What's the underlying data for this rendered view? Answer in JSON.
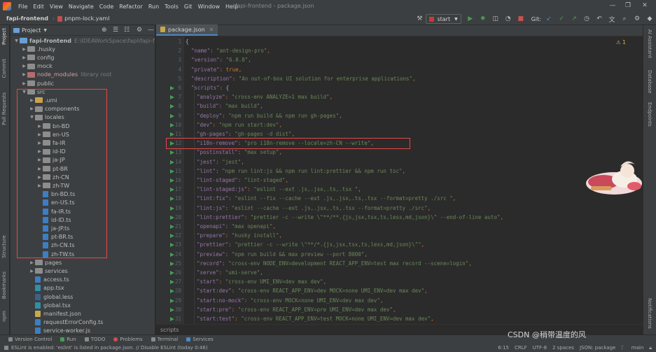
{
  "menu": {
    "items": [
      "File",
      "Edit",
      "View",
      "Navigate",
      "Code",
      "Refactor",
      "Run",
      "Tools",
      "Git",
      "Window",
      "Help"
    ],
    "window_title": "fapi-frontend - package.json"
  },
  "nav": {
    "project": "fapi-frontend",
    "file": "pnpm-lock.yaml",
    "run_config": "start",
    "git_label": "Git:"
  },
  "left_strip": {
    "project": "Project",
    "commit": "Commit",
    "pull_requests": "Pull Requests",
    "structure": "Structure",
    "bookmarks": "Bookmarks",
    "npm": "npm"
  },
  "project_panel": {
    "title": "Project",
    "tree": [
      {
        "label": "fapi-frontend",
        "note": "E:\\IDEAWorkSpace\\fapi\\fapi-fronte",
        "depth": 0,
        "kind": "folder",
        "open": true
      },
      {
        "label": ".husky",
        "depth": 1,
        "kind": "folder"
      },
      {
        "label": "config",
        "depth": 1,
        "kind": "folder"
      },
      {
        "label": "mock",
        "depth": 1,
        "kind": "folder"
      },
      {
        "label": "node_modules",
        "note": "library root",
        "depth": 1,
        "kind": "folder-excluded"
      },
      {
        "label": "public",
        "depth": 1,
        "kind": "folder"
      },
      {
        "label": "src",
        "depth": 1,
        "kind": "folder",
        "open": true
      },
      {
        "label": ".umi",
        "depth": 2,
        "kind": "folder-orange"
      },
      {
        "label": "components",
        "depth": 2,
        "kind": "folder"
      },
      {
        "label": "locales",
        "depth": 2,
        "kind": "folder",
        "open": true
      },
      {
        "label": "bn-BD",
        "depth": 3,
        "kind": "folder"
      },
      {
        "label": "en-US",
        "depth": 3,
        "kind": "folder"
      },
      {
        "label": "fa-IR",
        "depth": 3,
        "kind": "folder"
      },
      {
        "label": "id-ID",
        "depth": 3,
        "kind": "folder"
      },
      {
        "label": "ja-JP",
        "depth": 3,
        "kind": "folder"
      },
      {
        "label": "pt-BR",
        "depth": 3,
        "kind": "folder"
      },
      {
        "label": "zh-CN",
        "depth": 3,
        "kind": "folder"
      },
      {
        "label": "zh-TW",
        "depth": 3,
        "kind": "folder"
      },
      {
        "label": "bn-BD.ts",
        "depth": 3,
        "kind": "ts"
      },
      {
        "label": "en-US.ts",
        "depth": 3,
        "kind": "ts"
      },
      {
        "label": "fa-IR.ts",
        "depth": 3,
        "kind": "ts"
      },
      {
        "label": "id-ID.ts",
        "depth": 3,
        "kind": "ts"
      },
      {
        "label": "ja-JP.ts",
        "depth": 3,
        "kind": "ts"
      },
      {
        "label": "pt-BR.ts",
        "depth": 3,
        "kind": "ts"
      },
      {
        "label": "zh-CN.ts",
        "depth": 3,
        "kind": "ts"
      },
      {
        "label": "zh-TW.ts",
        "depth": 3,
        "kind": "ts"
      },
      {
        "label": "pages",
        "depth": 2,
        "kind": "folder"
      },
      {
        "label": "services",
        "depth": 2,
        "kind": "folder"
      },
      {
        "label": "access.ts",
        "depth": 2,
        "kind": "ts"
      },
      {
        "label": "app.tsx",
        "depth": 2,
        "kind": "tsx"
      },
      {
        "label": "global.less",
        "depth": 2,
        "kind": "less"
      },
      {
        "label": "global.tsx",
        "depth": 2,
        "kind": "tsx"
      },
      {
        "label": "manifest.json",
        "depth": 2,
        "kind": "json"
      },
      {
        "label": "requestErrorConfig.ts",
        "depth": 2,
        "kind": "ts"
      },
      {
        "label": "service-worker.js",
        "depth": 2,
        "kind": "ts"
      }
    ]
  },
  "editor": {
    "tab": "package.json",
    "warnings": "1",
    "breadcrumb": "scripts",
    "lines": [
      {
        "n": "1",
        "t": "{"
      },
      {
        "n": "2",
        "k": "\"name\"",
        "v": "\"ant-design-pro\""
      },
      {
        "n": "3",
        "k": "\"version\"",
        "v": "\"6.0.0\""
      },
      {
        "n": "4",
        "k": "\"private\"",
        "v": "true",
        "lit": true
      },
      {
        "n": "5",
        "k": "\"description\"",
        "v": "\"An out-of-box UI solution for enterprise applications\""
      },
      {
        "n": "6",
        "k": "\"scripts\"",
        "v": "{",
        "open": true,
        "run": true
      },
      {
        "n": "7",
        "k": "\"analyze\"",
        "v": "\"cross-env ANALYZE=1 max build\"",
        "in": true,
        "run": true
      },
      {
        "n": "8",
        "k": "\"build\"",
        "v": "\"max build\"",
        "in": true,
        "run": true
      },
      {
        "n": "9",
        "k": "\"deploy\"",
        "v": "\"npm run build && npm run gh-pages\"",
        "in": true,
        "run": true
      },
      {
        "n": "10",
        "k": "\"dev\"",
        "v": "\"npm run start:dev\"",
        "in": true,
        "run": true
      },
      {
        "n": "11",
        "k": "\"gh-pages\"",
        "v": "\"gh-pages -d dist\"",
        "in": true,
        "run": true
      },
      {
        "n": "12",
        "k": "\"i18n-remove\"",
        "v": "\"pro i18n-remove --locale=zh-CN --write\"",
        "in": true,
        "run": true
      },
      {
        "n": "13",
        "k": "\"postinstall\"",
        "v": "\"max setup\"",
        "in": true,
        "run": true
      },
      {
        "n": "14",
        "k": "\"jest\"",
        "v": "\"jest\"",
        "in": true,
        "run": true
      },
      {
        "n": "15",
        "k": "\"lint\"",
        "v": "\"npm run lint:js && npm run lint:prettier && npm run tsc\"",
        "in": true,
        "run": true
      },
      {
        "n": "16",
        "k": "\"lint-staged\"",
        "v": "\"lint-staged\"",
        "in": true,
        "run": true
      },
      {
        "n": "17",
        "k": "\"lint-staged:js\"",
        "v": "\"eslint --ext .js,.jsx,.ts,.tsx \"",
        "in": true,
        "run": true
      },
      {
        "n": "18",
        "k": "\"lint:fix\"",
        "v": "\"eslint --fix --cache --ext .js,.jsx,.ts,.tsx --format=pretty ./src \"",
        "in": true,
        "run": true
      },
      {
        "n": "19",
        "k": "\"lint:js\"",
        "v": "\"eslint --cache --ext .js,.jsx,.ts,.tsx --format=pretty ./src\"",
        "in": true,
        "run": true
      },
      {
        "n": "20",
        "k": "\"lint:prettier\"",
        "v": "\"prettier -c --write \\\"**/**.{js,jsx,tsx,ts,less,md,json}\\\" --end-of-line auto\"",
        "in": true,
        "run": true
      },
      {
        "n": "21",
        "k": "\"openapi\"",
        "v": "\"max openapi\"",
        "in": true,
        "run": true
      },
      {
        "n": "22",
        "k": "\"prepare\"",
        "v": "\"husky install\"",
        "in": true,
        "run": true
      },
      {
        "n": "23",
        "k": "\"prettier\"",
        "v": "\"prettier -c --write \\\"**/*.{js,jsx,tsx,ts,less,md,json}\\\"\"",
        "in": true,
        "run": true
      },
      {
        "n": "24",
        "k": "\"preview\"",
        "v": "\"npm run build && max preview --port 8000\"",
        "in": true,
        "run": true
      },
      {
        "n": "25",
        "k": "\"record\"",
        "v": "\"cross-env NODE_ENV=development REACT_APP_ENV=test max record --scene=login\"",
        "in": true,
        "run": true
      },
      {
        "n": "26",
        "k": "\"serve\"",
        "v": "\"umi-serve\"",
        "in": true,
        "run": true
      },
      {
        "n": "27",
        "k": "\"start\"",
        "v": "\"cross-env UMI_ENV=dev max dev\"",
        "in": true,
        "run": true
      },
      {
        "n": "28",
        "k": "\"start:dev\"",
        "v": "\"cross-env REACT_APP_ENV=dev MOCK=none UMI_ENV=dev max dev\"",
        "in": true,
        "run": true
      },
      {
        "n": "29",
        "k": "\"start:no-mock\"",
        "v": "\"cross-env MOCK=none UMI_ENV=dev max dev\"",
        "in": true,
        "run": true
      },
      {
        "n": "30",
        "k": "\"start:pre\"",
        "v": "\"cross-env REACT_APP_ENV=pre UMI_ENV=dev max dev\"",
        "in": true,
        "run": true
      },
      {
        "n": "31",
        "k": "\"start:test\"",
        "v": "\"cross-env REACT_APP_ENV=test MOCK=none UMI_ENV=dev max dev\"",
        "in": true,
        "run": true
      }
    ]
  },
  "right_strip": {
    "ai": "AI Assistant",
    "database": "Database",
    "endpoints": "Endpoints",
    "notifications": "Notifications"
  },
  "tool_tabs": [
    "Version Control",
    "Run",
    "TODO",
    "Problems",
    "Terminal",
    "Services"
  ],
  "status": {
    "message": "ESLint is enabled: 'eslint' is listed in package.json. // Disable ESLint (today 0:46)",
    "position": "6:15",
    "line_sep": "CRLF",
    "encoding": "UTF-8",
    "indent": "2 spaces",
    "schema": "JSON: package",
    "branch": "main"
  },
  "watermark": "CSDN @稍带温度的风",
  "colors": {
    "highlight_border": "#e84646",
    "json_key": "#9876aa",
    "json_string": "#6a8759",
    "run_icon": "#499c54"
  }
}
